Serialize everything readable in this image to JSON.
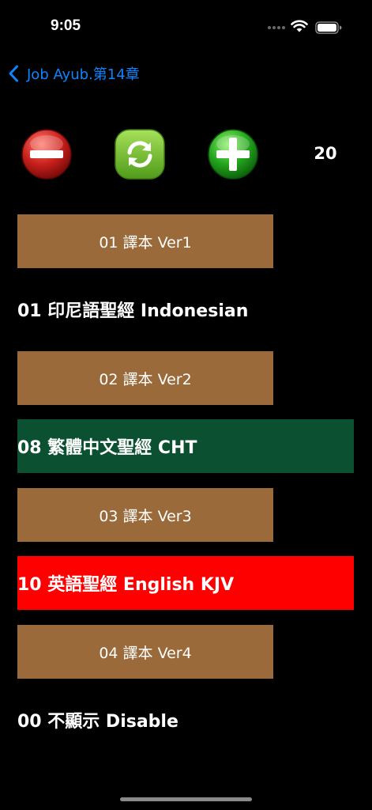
{
  "status": {
    "time": "9:05"
  },
  "nav": {
    "back_label": "Job Ayub.第14章"
  },
  "controls": {
    "count": "20",
    "icons": [
      "minus-icon",
      "refresh-icon",
      "plus-icon"
    ]
  },
  "versions": [
    {
      "button_label": "01 譯本 Ver1",
      "selected": "01 印尼語聖經 Indonesian",
      "highlight": "#000000"
    },
    {
      "button_label": "02 譯本 Ver2",
      "selected": "08 繁體中文聖經 CHT",
      "highlight": "#0b5030"
    },
    {
      "button_label": "03 譯本 Ver3",
      "selected": "10 英語聖經 English KJV",
      "highlight": "#ff0000"
    },
    {
      "button_label": "04 譯本 Ver4",
      "selected": "00 不顯示 Disable",
      "highlight": "#000000"
    }
  ],
  "colors": {
    "accent": "#0a84ff",
    "version_button": "#9a6a3a"
  }
}
